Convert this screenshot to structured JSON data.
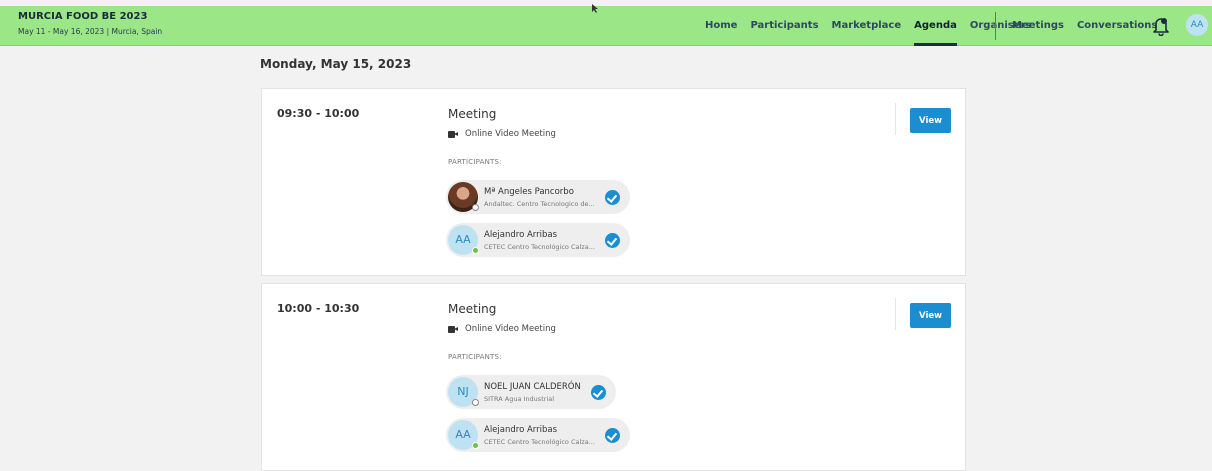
{
  "event": {
    "title": "MURCIA FOOD BE 2023",
    "subtitle": "May 11 - May 16, 2023 | Murcia, Spain"
  },
  "nav": {
    "home": "Home",
    "participants": "Participants",
    "marketplace": "Marketplace",
    "agenda": "Agenda",
    "organisers": "Organisers",
    "meetings": "Meetings",
    "conversations": "Conversations"
  },
  "user": {
    "initials": "AA"
  },
  "icons": {
    "notifications": "bell-icon",
    "meeting_type": "video-camera-icon",
    "confirmed": "check-circle-icon"
  },
  "colors": {
    "topbar": "#9be788",
    "accent": "#1a8ed0",
    "avatar_bg": "#bfe2f2",
    "online": "#6cc04a"
  },
  "date_heading": "Monday, May 15, 2023",
  "meetings": [
    {
      "time": "09:30 - 10:00",
      "type": "Meeting",
      "mode": "Online Video Meeting",
      "participants_label": "PARTICIPANTS:",
      "view_label": "View",
      "participants": [
        {
          "name": "Mª Angeles Pancorbo",
          "org": "Andaltec. Centro Tecnologico de...",
          "initials": "",
          "status": "offline"
        },
        {
          "name": "Alejandro Arribas",
          "org": "CETEC Centro Tecnológico Calza...",
          "initials": "AA",
          "status": "online"
        }
      ]
    },
    {
      "time": "10:00 - 10:30",
      "type": "Meeting",
      "mode": "Online Video Meeting",
      "participants_label": "PARTICIPANTS:",
      "view_label": "View",
      "participants": [
        {
          "name": "NOEL JUAN CALDERÓN",
          "org": "SITRA Agua Industrial",
          "initials": "NJ",
          "status": "offline"
        },
        {
          "name": "Alejandro Arribas",
          "org": "CETEC Centro Tecnológico Calza...",
          "initials": "AA",
          "status": "online"
        }
      ]
    }
  ]
}
